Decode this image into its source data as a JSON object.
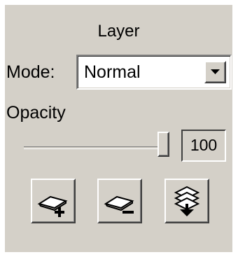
{
  "panel": {
    "title": "Layer"
  },
  "mode": {
    "label": "Mode:",
    "value": "Normal"
  },
  "opacity": {
    "label": "Opacity",
    "value": "100",
    "slider_fraction": 1.0
  },
  "buttons": [
    {
      "name": "new-layer",
      "icon": "layer-add-icon"
    },
    {
      "name": "delete-layer",
      "icon": "layer-remove-icon"
    },
    {
      "name": "merge-layers",
      "icon": "layer-merge-down-icon"
    }
  ]
}
